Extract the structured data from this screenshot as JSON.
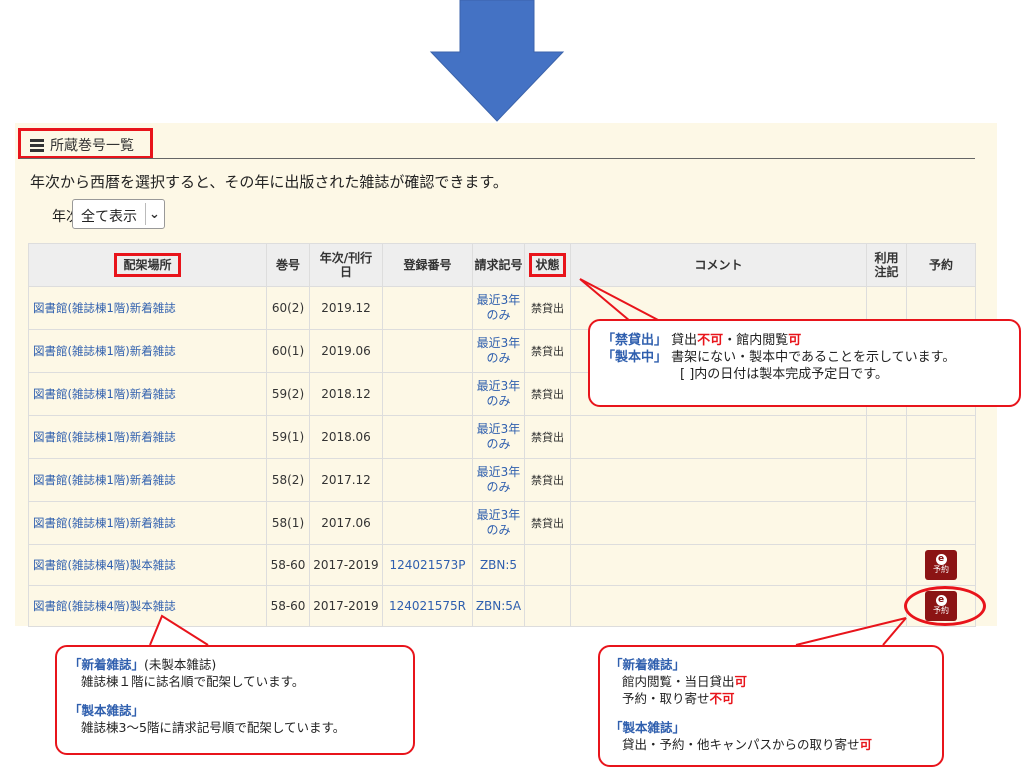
{
  "panel": {
    "title": "所蔵巻号一覧",
    "description": "年次から西暦を選択すると、その年に出版された雑誌が確認できます。",
    "year_filter": {
      "label": "年次",
      "selected": "全て表示"
    }
  },
  "table": {
    "headers": {
      "location": "配架場所",
      "volume": "巻号",
      "year_line1": "年次/刊行",
      "year_line2": "日",
      "reg_no": "登録番号",
      "call_no": "請求記号",
      "status": "状態",
      "comment": "コメント",
      "usage_line1": "利用",
      "usage_line2": "注記",
      "reserve": "予約"
    },
    "rows": [
      {
        "location": "図書館(雑誌棟1階)新着雑誌",
        "volume": "60(2)",
        "year": "2019.12",
        "reg_no": "",
        "call_no_line1": "最近3年",
        "call_no_line2": "のみ",
        "status": "禁貸出",
        "comment": "",
        "usage": ""
      },
      {
        "location": "図書館(雑誌棟1階)新着雑誌",
        "volume": "60(1)",
        "year": "2019.06",
        "reg_no": "",
        "call_no_line1": "最近3年",
        "call_no_line2": "のみ",
        "status": "禁貸出",
        "comment": "",
        "usage": ""
      },
      {
        "location": "図書館(雑誌棟1階)新着雑誌",
        "volume": "59(2)",
        "year": "2018.12",
        "reg_no": "",
        "call_no_line1": "最近3年",
        "call_no_line2": "のみ",
        "status": "禁貸出",
        "comment": "",
        "usage": ""
      },
      {
        "location": "図書館(雑誌棟1階)新着雑誌",
        "volume": "59(1)",
        "year": "2018.06",
        "reg_no": "",
        "call_no_line1": "最近3年",
        "call_no_line2": "のみ",
        "status": "禁貸出",
        "comment": "",
        "usage": ""
      },
      {
        "location": "図書館(雑誌棟1階)新着雑誌",
        "volume": "58(2)",
        "year": "2017.12",
        "reg_no": "",
        "call_no_line1": "最近3年",
        "call_no_line2": "のみ",
        "status": "禁貸出",
        "comment": "",
        "usage": ""
      },
      {
        "location": "図書館(雑誌棟1階)新着雑誌",
        "volume": "58(1)",
        "year": "2017.06",
        "reg_no": "",
        "call_no_line1": "最近3年",
        "call_no_line2": "のみ",
        "status": "禁貸出",
        "comment": "",
        "usage": ""
      },
      {
        "location": "図書館(雑誌棟4階)製本雑誌",
        "volume": "58-60",
        "year": "2017-2019",
        "reg_no": "124021573P",
        "call_no_line1": "ZBN:5",
        "call_no_line2": "",
        "status": "",
        "comment": "",
        "usage": "",
        "reserve_label": "予約"
      },
      {
        "location": "図書館(雑誌棟4階)製本雑誌",
        "volume": "58-60",
        "year": "2017-2019",
        "reg_no": "124021575R",
        "call_no_line1": "ZBN:5A",
        "call_no_line2": "",
        "status": "",
        "comment": "",
        "usage": "",
        "reserve_label": "予約"
      }
    ]
  },
  "callouts": {
    "status": {
      "line1_head": "「禁貸出」",
      "line1_a": "貸出",
      "line1_b": "不可",
      "line1_c": "・館内閲覧",
      "line1_d": "可",
      "line2_head": "「製本中」",
      "line2_text": "書架にない・製本中であることを示しています。",
      "line3_text": "[ ]内の日付は製本完成予定日です。"
    },
    "location": {
      "new_head": "「新着雑誌」",
      "new_suffix": "(未製本雑誌)",
      "new_text": "雑誌棟１階に誌名順で配架しています。",
      "bound_head": "「製本雑誌」",
      "bound_text": "雑誌棟3〜5階に請求記号順で配架しています。"
    },
    "reserve": {
      "new_head": "「新着雑誌」",
      "new_line1_a": "館内閲覧・当日貸出",
      "new_line1_b": "可",
      "new_line2_a": "予約・取り寄せ",
      "new_line2_b": "不可",
      "bound_head": "「製本雑誌」",
      "bound_line_a": "貸出・予約・他キャンパスからの取り寄せ",
      "bound_line_b": "可"
    }
  },
  "colors": {
    "accent_red": "#e8141b",
    "link_blue": "#2f5fae",
    "arrow_blue": "#4472c4",
    "panel_bg": "#fdf8e6",
    "reserve_button": "#8b1414"
  },
  "icons": {
    "title": "list-icon",
    "arrow": "down-arrow-icon",
    "reserve": "reserve-icon",
    "select": "chevron-down-icon"
  }
}
